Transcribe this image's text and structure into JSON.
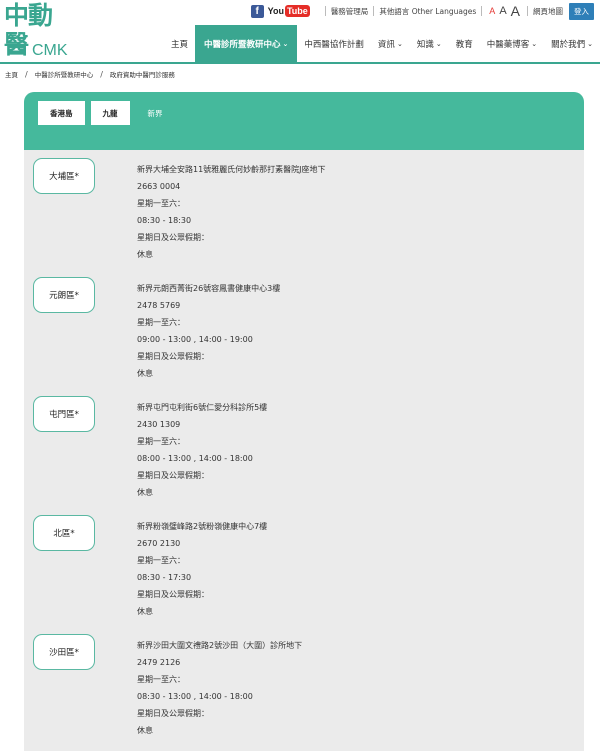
{
  "logo": {
    "line1": "中動",
    "line2": "醫",
    "cmk": "CMK"
  },
  "topbar": {
    "facebook": "f",
    "youtube_you": "You",
    "youtube_tube": "Tube",
    "links": [
      "醫務管理局",
      "其他語言 Other Languages"
    ],
    "font_sizes": [
      "A",
      "A",
      "A"
    ],
    "sitemap": "網頁地圖",
    "login": "登入"
  },
  "nav": {
    "items": [
      {
        "label": "主頁",
        "chevron": ""
      },
      {
        "label": "中醫診所暨教研中心",
        "chevron": "⌄",
        "active": true
      },
      {
        "label": "中西醫協作計劃",
        "chevron": ""
      },
      {
        "label": "資訊",
        "chevron": "⌄"
      },
      {
        "label": "知識",
        "chevron": "⌄"
      },
      {
        "label": "教育",
        "chevron": ""
      },
      {
        "label": "中醫藥博客",
        "chevron": "⌄"
      },
      {
        "label": "關於我們",
        "chevron": "⌄"
      }
    ]
  },
  "breadcrumb": {
    "items": [
      "主頁",
      "中醫診所暨教研中心",
      "政府資助中醫門診服務"
    ]
  },
  "tabs": [
    {
      "label": "香港島",
      "state": "inactive"
    },
    {
      "label": "九龍",
      "state": "inactive"
    },
    {
      "label": "新界",
      "state": "current"
    }
  ],
  "clinics": [
    {
      "district": "大埔區*",
      "address": "新界大埔全安路11號雅麗氏何妙齡那打素醫院J座地下",
      "phone": "2663 0004",
      "weekday_label": "星期一至六：",
      "weekday_hours": "08:30 - 18:30",
      "holiday_label": "星期日及公眾假期：",
      "holiday_hours": "休息"
    },
    {
      "district": "元朗區*",
      "address": "新界元朗西菁街26號容鳳書健康中心3樓",
      "phone": "2478 5769",
      "weekday_label": "星期一至六：",
      "weekday_hours": "09:00 - 13:00 , 14:00 - 19:00",
      "holiday_label": "星期日及公眾假期：",
      "holiday_hours": "休息"
    },
    {
      "district": "屯門區*",
      "address": "新界屯門屯利街6號仁愛分科診所5樓",
      "phone": "2430 1309",
      "weekday_label": "星期一至六：",
      "weekday_hours": "08:00 - 13:00 , 14:00 - 18:00",
      "holiday_label": "星期日及公眾假期：",
      "holiday_hours": "休息"
    },
    {
      "district": "北區*",
      "address": "新界粉嶺璧峰路2號粉嶺健康中心7樓",
      "phone": "2670 2130",
      "weekday_label": "星期一至六：",
      "weekday_hours": "08:30 - 17:30",
      "holiday_label": "星期日及公眾假期：",
      "holiday_hours": "休息"
    },
    {
      "district": "沙田區*",
      "address": "新界沙田大圍文禮路2號沙田（大圍）診所地下",
      "phone": "2479 2126",
      "weekday_label": "星期一至六：",
      "weekday_hours": "08:30 - 13:00 , 14:00 - 18:00",
      "holiday_label": "星期日及公眾假期：",
      "holiday_hours": "休息"
    }
  ],
  "colors": {
    "brand_green": "#3aa690",
    "band_green": "#45b99c",
    "panel_gray": "#ebebeb",
    "login_blue": "#2e7fb8"
  }
}
